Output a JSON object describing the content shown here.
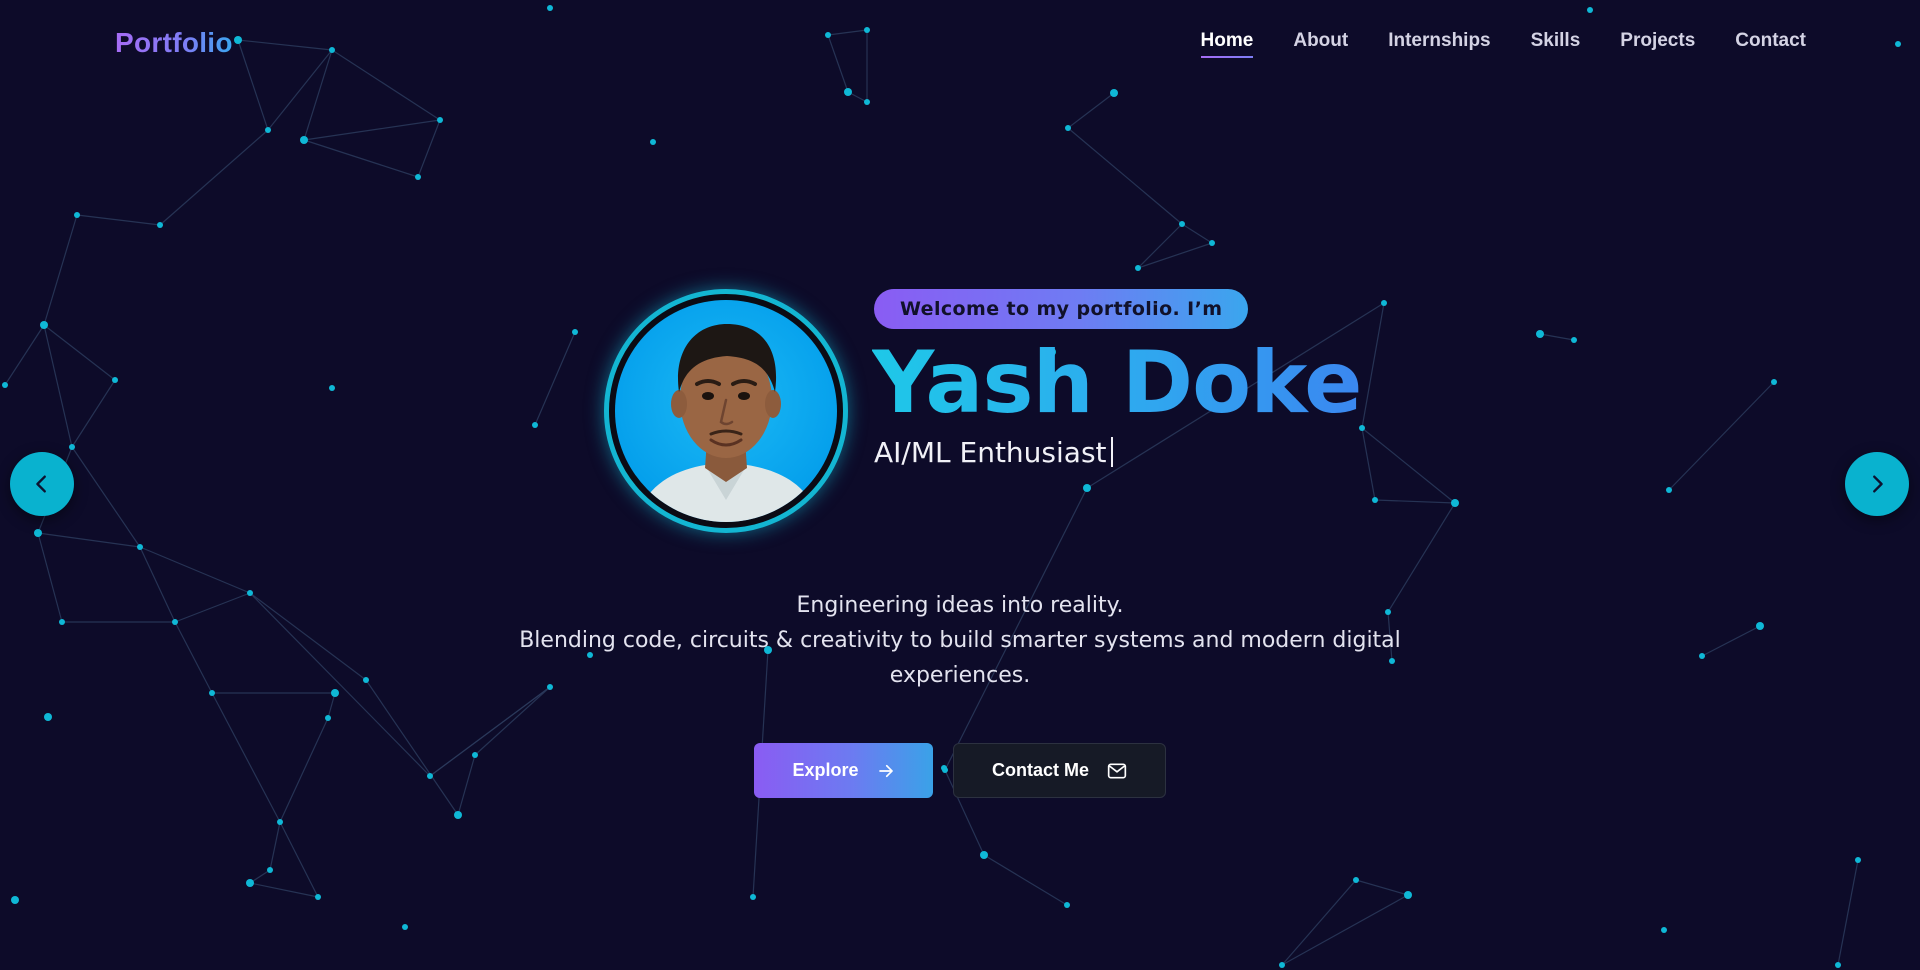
{
  "nav": {
    "logo": "Portfolio",
    "links": [
      {
        "label": "Home",
        "active": true
      },
      {
        "label": "About",
        "active": false
      },
      {
        "label": "Internships",
        "active": false
      },
      {
        "label": "Skills",
        "active": false
      },
      {
        "label": "Projects",
        "active": false
      },
      {
        "label": "Contact",
        "active": false
      }
    ]
  },
  "carousel": {
    "prev_icon": "chevron-left-icon",
    "next_icon": "chevron-right-icon"
  },
  "hero": {
    "welcome": "Welcome to my portfolio. I’m",
    "name": "Yash Doke",
    "role": "AI/ML Enthusiast",
    "tagline_line1": "Engineering ideas into reality.",
    "tagline_line2": "Blending code, circuits & creativity to build smarter systems and modern digital experiences.",
    "buttons": {
      "explore": "Explore",
      "explore_icon": "arrow-right-icon",
      "contact": "Contact Me",
      "contact_icon": "mail-icon"
    }
  },
  "colors": {
    "background": "#0d0b29",
    "accent_cyan": "#09b2cf",
    "accent_purple": "#8a5cf3",
    "accent_blue": "#3aa6f0",
    "network_node": "#0fb8d6",
    "network_line": "#2b3a5c"
  }
}
